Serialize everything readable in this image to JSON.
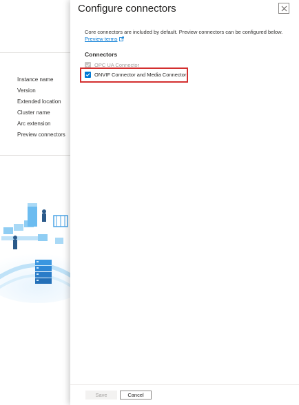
{
  "background": {
    "labels": [
      "Instance name",
      "Version",
      "Extended location",
      "Cluster name",
      "Arc extension",
      "Preview connectors"
    ]
  },
  "panel": {
    "title": "Configure connectors",
    "intro": "Core connectors are included by default. Preview connectors can be configured below.",
    "preview_link": "Preview terms",
    "section_heading": "Connectors",
    "connectors": [
      {
        "label": "OPC UA Connector",
        "checked": true,
        "disabled": true
      },
      {
        "label": "ONVIF Connector and Media Connector",
        "checked": true,
        "disabled": false
      }
    ],
    "save_label": "Save",
    "cancel_label": "Cancel"
  },
  "colors": {
    "accent": "#0078d4",
    "highlight": "#d32f2f",
    "disabled": "#c8c6c4"
  }
}
